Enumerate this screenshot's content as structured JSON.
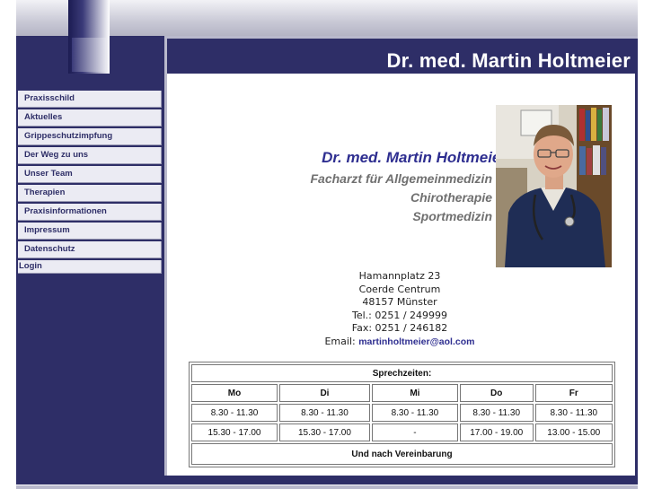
{
  "header": {
    "title": "Dr. med. Martin Holtmeier"
  },
  "menu": [
    {
      "label": "Praxisschild"
    },
    {
      "label": "Aktuelles"
    },
    {
      "label": "Grippeschutzimpfung"
    },
    {
      "label": "Der Weg zu uns"
    },
    {
      "label": "Unser Team"
    },
    {
      "label": "Therapien"
    },
    {
      "label": "Praxisinformationen"
    },
    {
      "label": "Impressum"
    },
    {
      "label": "Datenschutz"
    },
    {
      "label": "Login"
    }
  ],
  "intro": {
    "name": "Dr. med. Martin Holtmeier",
    "lines": [
      "Facharzt für Allgemeinmedizin",
      "Chirotherapie",
      "Sportmedizin"
    ]
  },
  "address": {
    "street": "Hamannplatz 23",
    "area": "Coerde Centrum",
    "city": "48157 Münster",
    "tel": "Tel.: 0251 / 249999",
    "fax": "Fax: 0251 / 246182",
    "email_label": "Email:",
    "email": "martinholtmeier@aol.com"
  },
  "hours": {
    "title": "Sprechzeiten:",
    "days": [
      "Mo",
      "Di",
      "Mi",
      "Do",
      "Fr"
    ],
    "morning": [
      "8.30 - 11.30",
      "8.30 - 11.30",
      "8.30 - 11.30",
      "8.30 - 11.30",
      "8.30 - 11.30"
    ],
    "afternoon": [
      "15.30 - 17.00",
      "15.30 - 17.00",
      "-",
      "17.00 - 19.00",
      "13.00 - 15.00"
    ],
    "footer": "Und nach Vereinbarung"
  },
  "colors": {
    "navy": "#2e2e67",
    "link": "#2e2e90",
    "subtitle": "#707070"
  }
}
